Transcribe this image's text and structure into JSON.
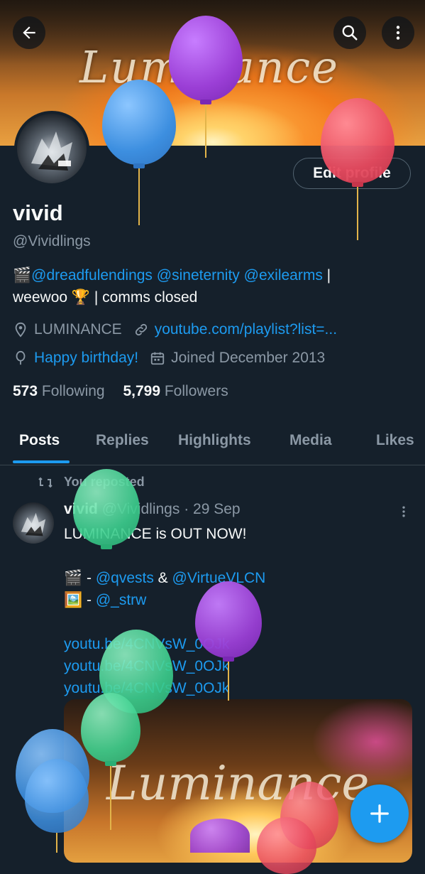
{
  "header": {
    "back_icon": "arrow-left-icon",
    "search_icon": "search-icon",
    "more_icon": "more-vertical-icon",
    "banner_text": "Luminance"
  },
  "profile": {
    "edit_label": "Edit profile",
    "name": "vivid",
    "handle": "@Vividlings",
    "bio_emoji": "🎬",
    "bio_mentions": [
      "@dreadfulendings",
      "@sineternity",
      "@exilearms"
    ],
    "bio_sep": " |",
    "bio_line2": "weewoo 🏆 | comms closed",
    "location": "LUMINANCE",
    "website": "youtube.com/playlist?list=...",
    "birthday": "Happy birthday!",
    "joined": "Joined December 2013",
    "following_count": "573",
    "following_label": "Following",
    "followers_count": "5,799",
    "followers_label": "Followers"
  },
  "tabs": [
    "Posts",
    "Replies",
    "Highlights",
    "Media",
    "Likes"
  ],
  "post": {
    "repost_label": "You reposted",
    "author_name": "vivid",
    "author_handle": "@Vividlings",
    "dot": "·",
    "date": "29 Sep",
    "line1": "LUMINANCE is OUT NOW!",
    "credit1_emoji": "🎬",
    "credit1_dash": " - ",
    "credit1_a": "@qvests",
    "credit1_amp": " & ",
    "credit1_b": "@VirtueVLCN",
    "credit2_emoji": "🖼️",
    "credit2_dash": " - ",
    "credit2_a": "@_strw",
    "links": [
      "youtu.be/4CNVsW_0OJk",
      "youtu.be/4CNVsW_0OJk",
      "youtu.be/4CNVsW_0OJk"
    ],
    "media_text": "Luminance"
  },
  "fab": {
    "icon": "plus-icon"
  },
  "colors": {
    "background": "#15202b",
    "accent": "#1d9bf0",
    "muted_text": "#8b98a5",
    "balloon_purple": "#9b3fd6",
    "balloon_blue": "#3d8fe0",
    "balloon_red": "#e84a5f",
    "balloon_green": "#3ccf8e"
  }
}
